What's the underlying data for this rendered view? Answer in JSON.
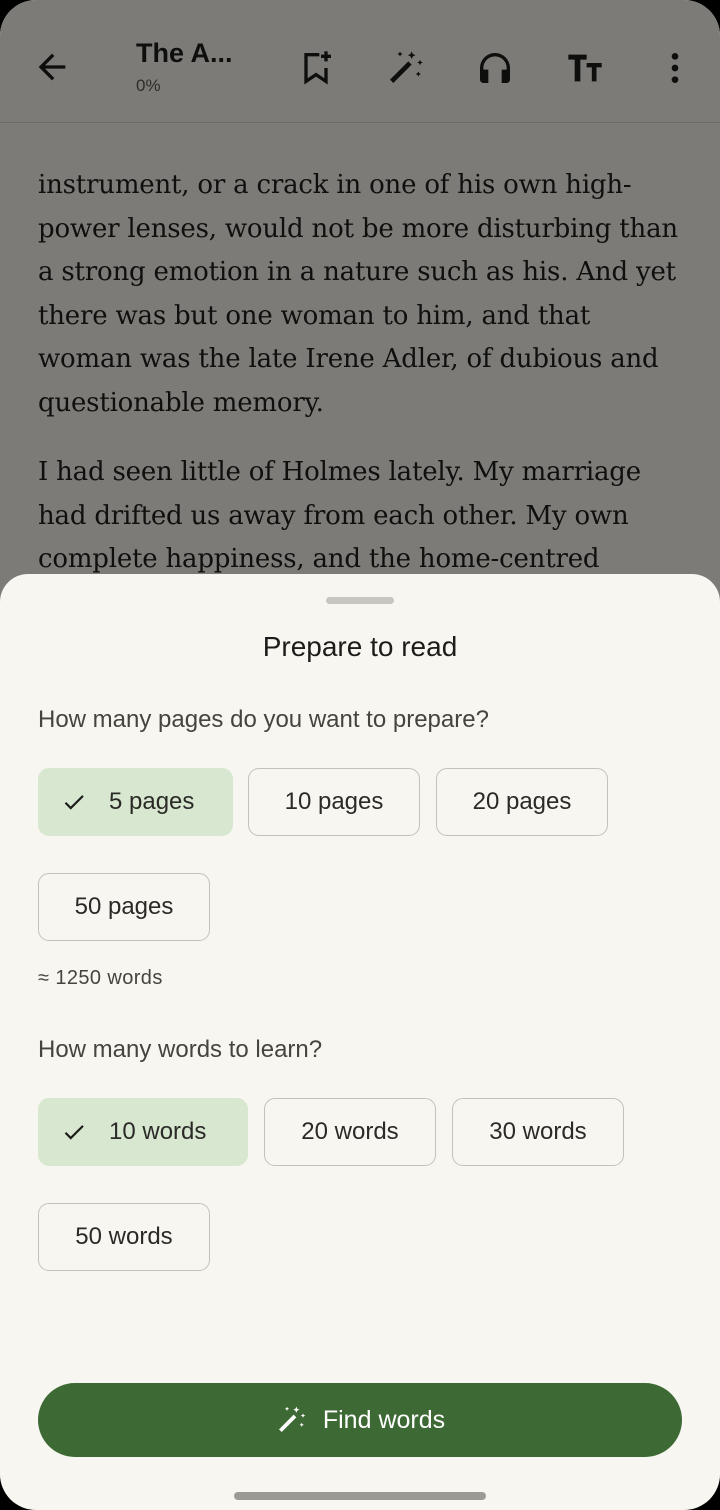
{
  "app_bar": {
    "title": "The A...",
    "progress": "0%",
    "icons": [
      "back-arrow-icon",
      "bookmark-add-icon",
      "magic-wand-icon",
      "headphones-icon",
      "text-size-icon",
      "more-vert-icon"
    ]
  },
  "reader": {
    "paragraphs": [
      "instrument, or a crack in one of his own high-power lenses, would not be more disturbing than a strong emotion in a nature such as his. And yet there was but one woman to him, and that woman was the late Irene Adler, of dubious and questionable memory.",
      "I had seen little of Holmes lately. My marriage had drifted us away from each other. My own complete happiness, and the home-centred"
    ]
  },
  "sheet": {
    "title": "Prepare to read",
    "pages_question": "How many pages do you want to prepare?",
    "page_options": [
      "5 pages",
      "10 pages",
      "20 pages",
      "50 pages"
    ],
    "page_selected": "5 pages",
    "words_estimate": "≈ 1250 words",
    "words_question": "How many words to learn?",
    "word_options": [
      "10 words",
      "20 words",
      "30 words",
      "50 words"
    ],
    "word_selected": "10 words",
    "action_label": "Find words"
  },
  "colors": {
    "accent": "#3d6934",
    "chip_selected": "#d8e8d0",
    "sheet_background": "#f8f6f1"
  }
}
